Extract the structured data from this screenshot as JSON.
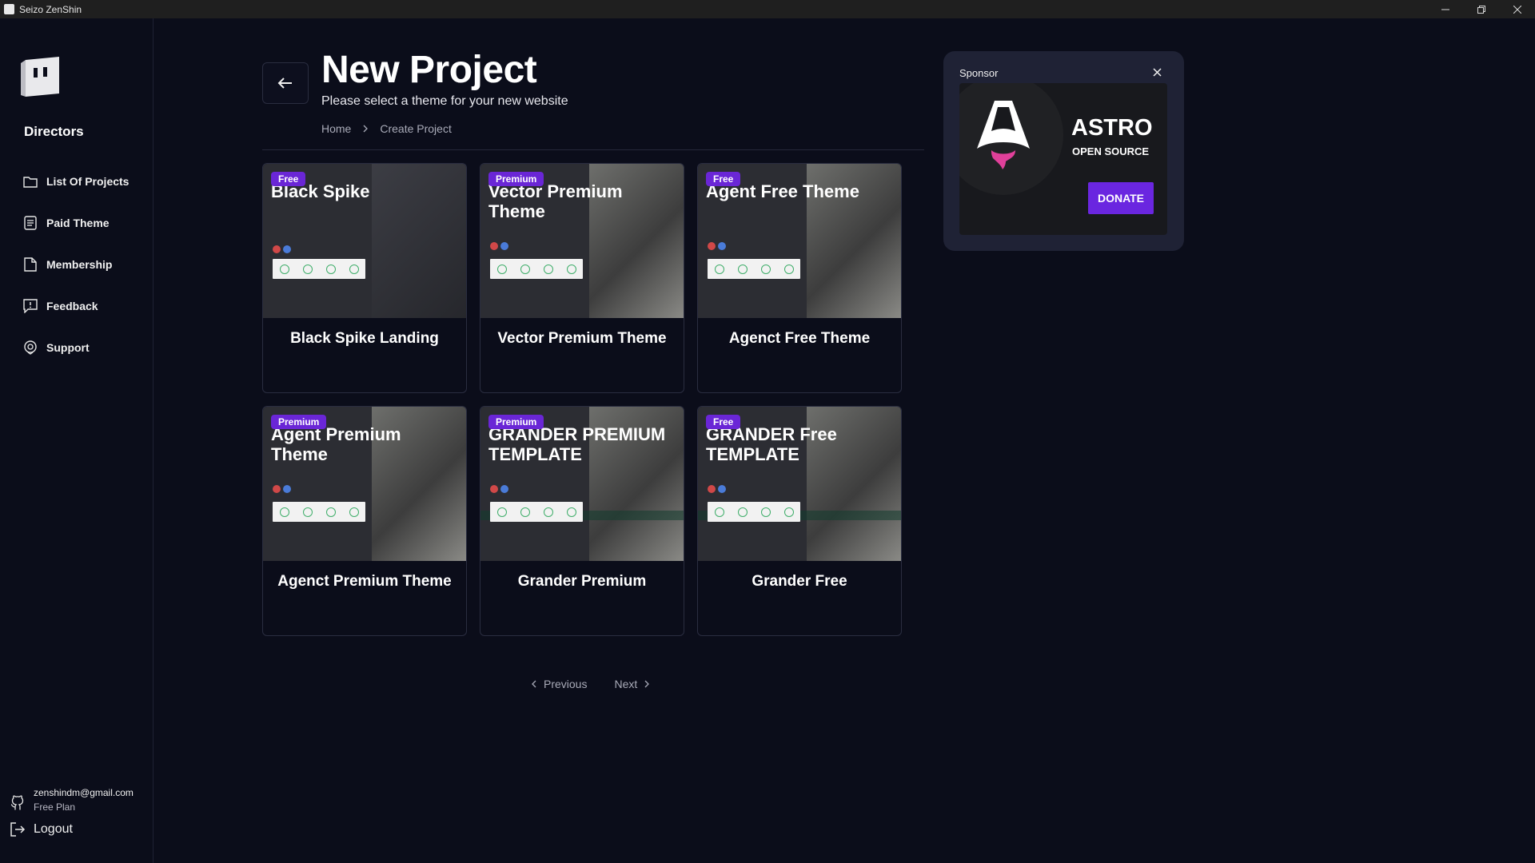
{
  "window": {
    "title": "Seizo ZenShin",
    "controls": [
      "minimize-icon",
      "restore-icon",
      "close-icon"
    ]
  },
  "sidebar": {
    "heading": "Directors",
    "items": [
      {
        "label": "List Of Projects",
        "icon": "folder-icon"
      },
      {
        "label": "Paid Theme",
        "icon": "document-icon"
      },
      {
        "label": "Membership",
        "icon": "file-icon"
      },
      {
        "label": "Feedback",
        "icon": "feedback-icon"
      },
      {
        "label": "Support",
        "icon": "support-icon"
      }
    ],
    "account": {
      "email": "zenshindm@gmail.com",
      "plan": "Free Plan"
    },
    "logout_label": "Logout"
  },
  "header": {
    "title": "New Project",
    "subtitle": "Please select a theme for your new website",
    "breadcrumb": [
      "Home",
      "Create Project"
    ]
  },
  "themes": [
    {
      "badge": "Free",
      "preview_title": "Black Spike",
      "name": "Black Spike Landing"
    },
    {
      "badge": "Premium",
      "preview_title": "Vector Premium Theme",
      "name": "Vector Premium Theme"
    },
    {
      "badge": "Free",
      "preview_title": "Agent Free Theme",
      "name": "Agenct Free Theme"
    },
    {
      "badge": "Premium",
      "preview_title": "Agent Premium Theme",
      "name": "Agenct Premium Theme"
    },
    {
      "badge": "Premium",
      "preview_title": "GRANDER PREMIUM TEMPLATE",
      "name": "Grander Premium"
    },
    {
      "badge": "Free",
      "preview_title": "GRANDER Free TEMPLATE",
      "name": "Grander Free"
    }
  ],
  "pagination": {
    "previous": "Previous",
    "next": "Next"
  },
  "sponsor": {
    "label": "Sponsor",
    "brand": "ASTRO",
    "tagline": "OPEN SOURCE",
    "cta": "DONATE"
  },
  "colors": {
    "background": "#0b0d1a",
    "accent": "#6a26d6",
    "sponsor_panel": "#1f2235"
  }
}
